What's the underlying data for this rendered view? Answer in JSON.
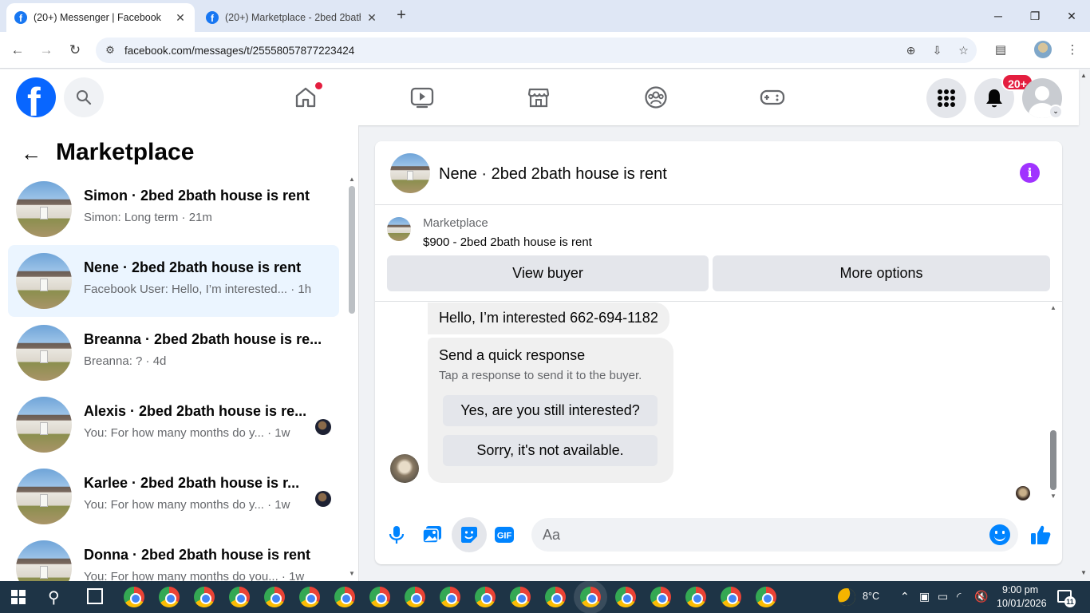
{
  "browser": {
    "tabs": [
      {
        "title": "(20+) Messenger | Facebook",
        "active": true
      },
      {
        "title": "(20+) Marketplace - 2bed 2bath",
        "active": false
      }
    ],
    "url": "facebook.com/messages/t/25558057877223424",
    "window_controls": {
      "minimize": "─",
      "restore": "❐",
      "close": "✕"
    },
    "new_tab": "+",
    "close_glyph": "✕"
  },
  "fb_nav": {
    "logo": "f",
    "notifications_badge": "20+",
    "icons": [
      "home-icon",
      "watch-icon",
      "marketplace-icon",
      "groups-icon",
      "gaming-icon",
      "menu-grid-icon",
      "bell-icon"
    ]
  },
  "left_panel": {
    "title": "Marketplace",
    "conversations": [
      {
        "title": "Simon · 2bed 2bath house is rent",
        "subtitle": "Simon: Long term · 21m",
        "active": false,
        "seen": false
      },
      {
        "title": "Nene · 2bed 2bath house is rent",
        "subtitle": "Facebook User: Hello, I’m interested... · 1h",
        "active": true,
        "seen": false
      },
      {
        "title": "Breanna · 2bed 2bath house is re...",
        "subtitle": "Breanna: ? · 4d",
        "active": false,
        "seen": false
      },
      {
        "title": "Alexis · 2bed 2bath house is re...",
        "subtitle": "You: For how many months do y... · 1w",
        "active": false,
        "seen": true
      },
      {
        "title": "Karlee · 2bed 2bath house is r...",
        "subtitle": "You: For how many months do y... · 1w",
        "active": false,
        "seen": true
      },
      {
        "title": "Donna · 2bed 2bath house is rent",
        "subtitle": "You: For how many months do you... · 1w",
        "active": false,
        "seen": false
      }
    ]
  },
  "chat": {
    "header_name": "Nene · 2bed 2bath house is rent",
    "info_glyph": "i",
    "listing": {
      "label": "Marketplace",
      "price_title": "$900 - 2bed 2bath house is rent",
      "view_buyer": "View buyer",
      "more_options": "More options"
    },
    "messages": {
      "incoming": "Hello, I’m interested 662-694-1182",
      "quick_title": "Send a quick response",
      "quick_sub": "Tap a response to send it to the buyer.",
      "quick_replies": [
        "Yes, are you still interested?",
        "Sorry, it's not available."
      ]
    },
    "composer": {
      "placeholder": "Aa"
    }
  },
  "taskbar": {
    "weather": "8°C",
    "time": "9:00 pm",
    "date": "10/01/2026",
    "notification_count": "11",
    "app_count": 19
  },
  "colors": {
    "fb_blue": "#0866ff",
    "messenger_blue": "#0084ff",
    "active_convo": "#ebf5ff",
    "badge_red": "#e41e3f",
    "info_purple": "#a033ff"
  }
}
